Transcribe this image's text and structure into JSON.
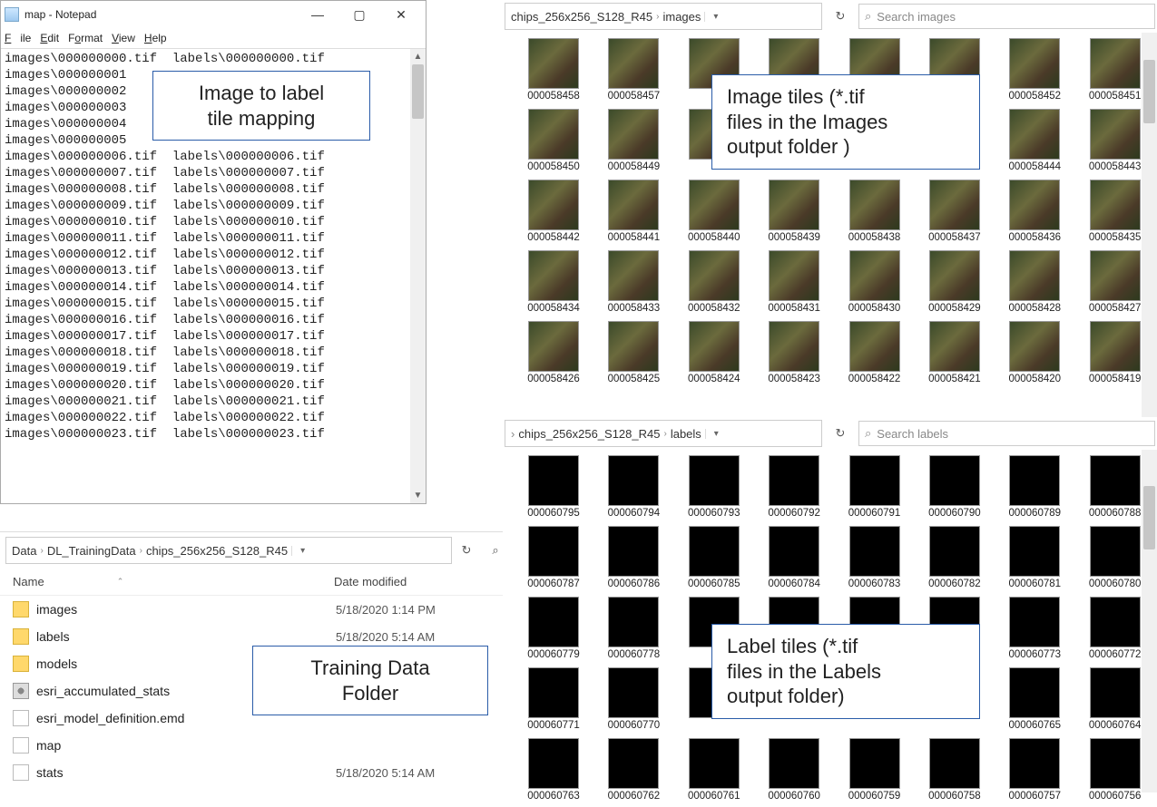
{
  "notepad": {
    "title": "map - Notepad",
    "menu": {
      "file": "File",
      "edit": "Edit",
      "format": "Format",
      "view": "View",
      "help": "Help"
    },
    "min": "—",
    "max": "▢",
    "close": "✕",
    "lines": [
      "images\\000000000.tif  labels\\000000000.tif",
      "images\\000000001",
      "images\\000000002",
      "images\\000000003",
      "images\\000000004",
      "images\\000000005",
      "images\\000000006.tif  labels\\000000006.tif",
      "images\\000000007.tif  labels\\000000007.tif",
      "images\\000000008.tif  labels\\000000008.tif",
      "images\\000000009.tif  labels\\000000009.tif",
      "images\\000000010.tif  labels\\000000010.tif",
      "images\\000000011.tif  labels\\000000011.tif",
      "images\\000000012.tif  labels\\000000012.tif",
      "images\\000000013.tif  labels\\000000013.tif",
      "images\\000000014.tif  labels\\000000014.tif",
      "images\\000000015.tif  labels\\000000015.tif",
      "images\\000000016.tif  labels\\000000016.tif",
      "images\\000000017.tif  labels\\000000017.tif",
      "images\\000000018.tif  labels\\000000018.tif",
      "images\\000000019.tif  labels\\000000019.tif",
      "images\\000000020.tif  labels\\000000020.tif",
      "images\\000000021.tif  labels\\000000021.tif",
      "images\\000000022.tif  labels\\000000022.tif",
      "images\\000000023.tif  labels\\000000023.tif"
    ]
  },
  "explorer_train": {
    "breadcrumb": [
      "Data",
      "DL_TrainingData",
      "chips_256x256_S128_R45"
    ],
    "dropdown_glyph": "▾",
    "refresh_glyph": "↻",
    "search_glyph": "⌕",
    "col_name": "Name",
    "col_date": "Date modified",
    "sort_glyph": "⌃",
    "items": [
      {
        "name": "images",
        "date": "5/18/2020 1:14 PM",
        "icon": "folder"
      },
      {
        "name": "labels",
        "date": "5/18/2020 5:14 AM",
        "icon": "folder"
      },
      {
        "name": "models",
        "date": "",
        "icon": "folder"
      },
      {
        "name": "esri_accumulated_stats",
        "date": "",
        "icon": "gear"
      },
      {
        "name": "esri_model_definition.emd",
        "date": "",
        "icon": "file"
      },
      {
        "name": "map",
        "date": "",
        "icon": "file"
      },
      {
        "name": "stats",
        "date": "5/18/2020 5:14 AM",
        "icon": "file"
      }
    ]
  },
  "explorer_images": {
    "breadcrumb": [
      "chips_256x256_S128_R45",
      "images"
    ],
    "dropdown_glyph": "▾",
    "refresh_glyph": "↻",
    "search_placeholder": "Search images",
    "search_glyph": "⌕",
    "tiles": [
      "000058458",
      "000058457",
      "",
      "",
      "",
      "",
      "000058452",
      "000058451",
      "000058450",
      "000058449",
      "",
      "",
      "",
      "",
      "000058444",
      "000058443",
      "000058442",
      "000058441",
      "000058440",
      "000058439",
      "000058438",
      "000058437",
      "000058436",
      "000058435",
      "000058434",
      "000058433",
      "000058432",
      "000058431",
      "000058430",
      "000058429",
      "000058428",
      "000058427",
      "000058426",
      "000058425",
      "000058424",
      "000058423",
      "000058422",
      "000058421",
      "000058420",
      "000058419"
    ]
  },
  "explorer_labels": {
    "breadcrumb": [
      "chips_256x256_S128_R45",
      "labels"
    ],
    "dropdown_glyph": "▾",
    "refresh_glyph": "↻",
    "search_placeholder": "Search labels",
    "search_glyph": "⌕",
    "tiles": [
      "000060795",
      "000060794",
      "000060793",
      "000060792",
      "000060791",
      "000060790",
      "000060789",
      "000060788",
      "000060787",
      "000060786",
      "000060785",
      "000060784",
      "000060783",
      "000060782",
      "000060781",
      "000060780",
      "000060779",
      "000060778",
      "",
      "",
      "",
      "",
      "000060773",
      "000060772",
      "000060771",
      "000060770",
      "",
      "",
      "",
      "",
      "000060765",
      "000060764",
      "000060763",
      "000060762",
      "000060761",
      "000060760",
      "000060759",
      "000060758",
      "000060757",
      "000060756"
    ]
  },
  "callouts": {
    "mapping": "Image to label\ntile mapping",
    "training": "Training Data\nFolder",
    "imgtiles": "Image tiles (*.tif\nfiles in the Images\noutput folder )",
    "lbltiles": "Label tiles (*.tif\nfiles in the Labels\noutput folder)"
  }
}
